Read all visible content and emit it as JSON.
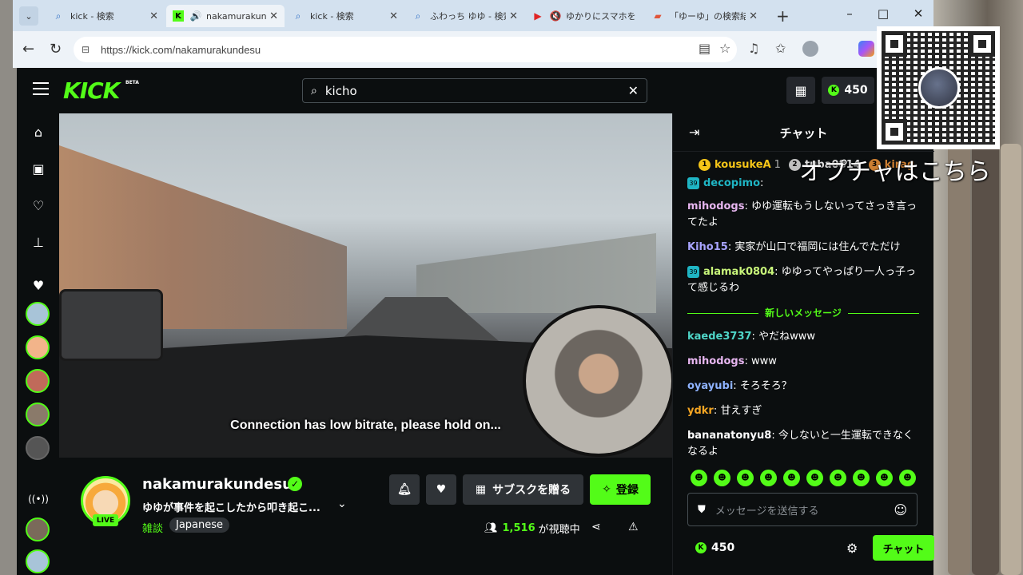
{
  "browser": {
    "tabs": [
      {
        "label": "kick - 検索",
        "icon": "search-icon"
      },
      {
        "label": "nakamurakundesu",
        "icon": "kick-favicon"
      },
      {
        "label": "kick - 検索",
        "icon": "search-icon"
      },
      {
        "label": "ふわっち ゆゆ - 検索",
        "icon": "search-icon"
      },
      {
        "label": "ゆかりにスマホを",
        "icon": "youtube-favicon"
      },
      {
        "label": "「ゆーゆ」の検索結果",
        "icon": "pdf-favicon"
      }
    ],
    "url": "https://kick.com/nakamurakundesu"
  },
  "kick": {
    "logo": "KICK",
    "beta": "BETA",
    "search_value": "kicho",
    "kicks_balance": "450"
  },
  "video": {
    "bitrate_notice": "Connection has low bitrate, please hold on..."
  },
  "channel": {
    "name": "nakamurakundesu",
    "live": "LIVE",
    "title": "ゆゆが事件を起こしたから叩き起こ...",
    "category": "雑談",
    "language": "Japanese",
    "gift_sub_label": "サブスクを贈る",
    "follow_label": "登録",
    "viewer_count": "1,516",
    "viewer_suffix": "が視聴中"
  },
  "chat": {
    "title": "チャット",
    "leaderboard": [
      {
        "rank": "1",
        "name": "kousukeA",
        "count": "1",
        "color": "#f5c518"
      },
      {
        "rank": "2",
        "name": "tuba0814",
        "count": "",
        "color": "#c0c0c0"
      },
      {
        "rank": "3",
        "name": "kirag",
        "count": "",
        "color": "#cd7f32"
      }
    ],
    "messages": [
      {
        "user": "decopimo",
        "color": "#1fb5c4",
        "text": "",
        "badge": "39"
      },
      {
        "user": "mihodogs",
        "color": "#e7b6f0",
        "text": "ゆゆ運転もうしないってさっき言ってたよ"
      },
      {
        "user": "Kiho15",
        "color": "#a8a4ff",
        "text": "実家が山口で福岡には住んでただけ"
      },
      {
        "user": "alamak0804",
        "color": "#c8f57a",
        "text": "ゆゆってやっぱり一人っ子って感じるわ",
        "badge": "39"
      }
    ],
    "new_messages_label": "新しいメッセージ",
    "new_messages": [
      {
        "user": "kaede3737",
        "color": "#4fd6c8",
        "text": "やだねwww"
      },
      {
        "user": "mihodogs",
        "color": "#e7b6f0",
        "text": "www"
      },
      {
        "user": "oyayubi",
        "color": "#8fb3ff",
        "text": "そろそろ？"
      },
      {
        "user": "ydkr",
        "color": "#f5a623",
        "text": "甘えすぎ"
      },
      {
        "user": "bananatonyu8",
        "color": "#ffffff",
        "text": "今しないと一生運転できなくなるよ"
      }
    ],
    "input_placeholder": "メッセージを送信する",
    "kicks": "450",
    "send_label": "チャット"
  },
  "overlay": {
    "caption": "オプチャはこちら"
  }
}
